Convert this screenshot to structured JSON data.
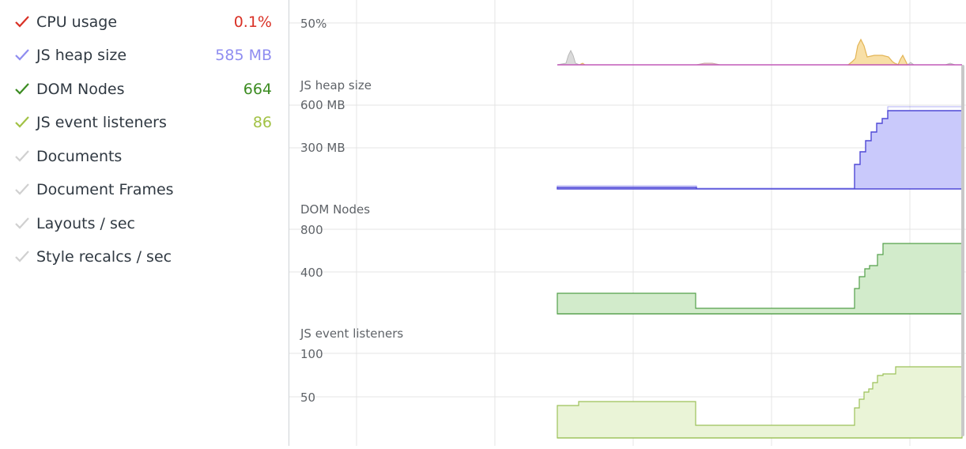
{
  "sidebar": {
    "metrics": [
      {
        "label": "CPU usage",
        "value": "0.1%",
        "checked": true,
        "color": "#d93025"
      },
      {
        "label": "JS heap size",
        "value": "585 MB",
        "checked": true,
        "color": "#8f8df0"
      },
      {
        "label": "DOM Nodes",
        "value": "664",
        "checked": true,
        "color": "#3c8c22"
      },
      {
        "label": "JS event listeners",
        "value": "86",
        "checked": true,
        "color": "#a2c245"
      },
      {
        "label": "Documents",
        "value": "",
        "checked": false,
        "color": "#cfcfcf"
      },
      {
        "label": "Document Frames",
        "value": "",
        "checked": false,
        "color": "#cfcfcf"
      },
      {
        "label": "Layouts / sec",
        "value": "",
        "checked": false,
        "color": "#cfcfcf"
      },
      {
        "label": "Style recalcs / sec",
        "value": "",
        "checked": false,
        "color": "#cfcfcf"
      }
    ]
  },
  "charts": {
    "cpu": {
      "label": "",
      "ticks": [
        "50%"
      ]
    },
    "heap": {
      "label": "JS heap size",
      "ticks": [
        "600 MB",
        "300 MB"
      ]
    },
    "dom": {
      "label": "DOM Nodes",
      "ticks": [
        "800",
        "400"
      ]
    },
    "listeners": {
      "label": "JS event listeners",
      "ticks": [
        "100",
        "50"
      ]
    }
  }
}
